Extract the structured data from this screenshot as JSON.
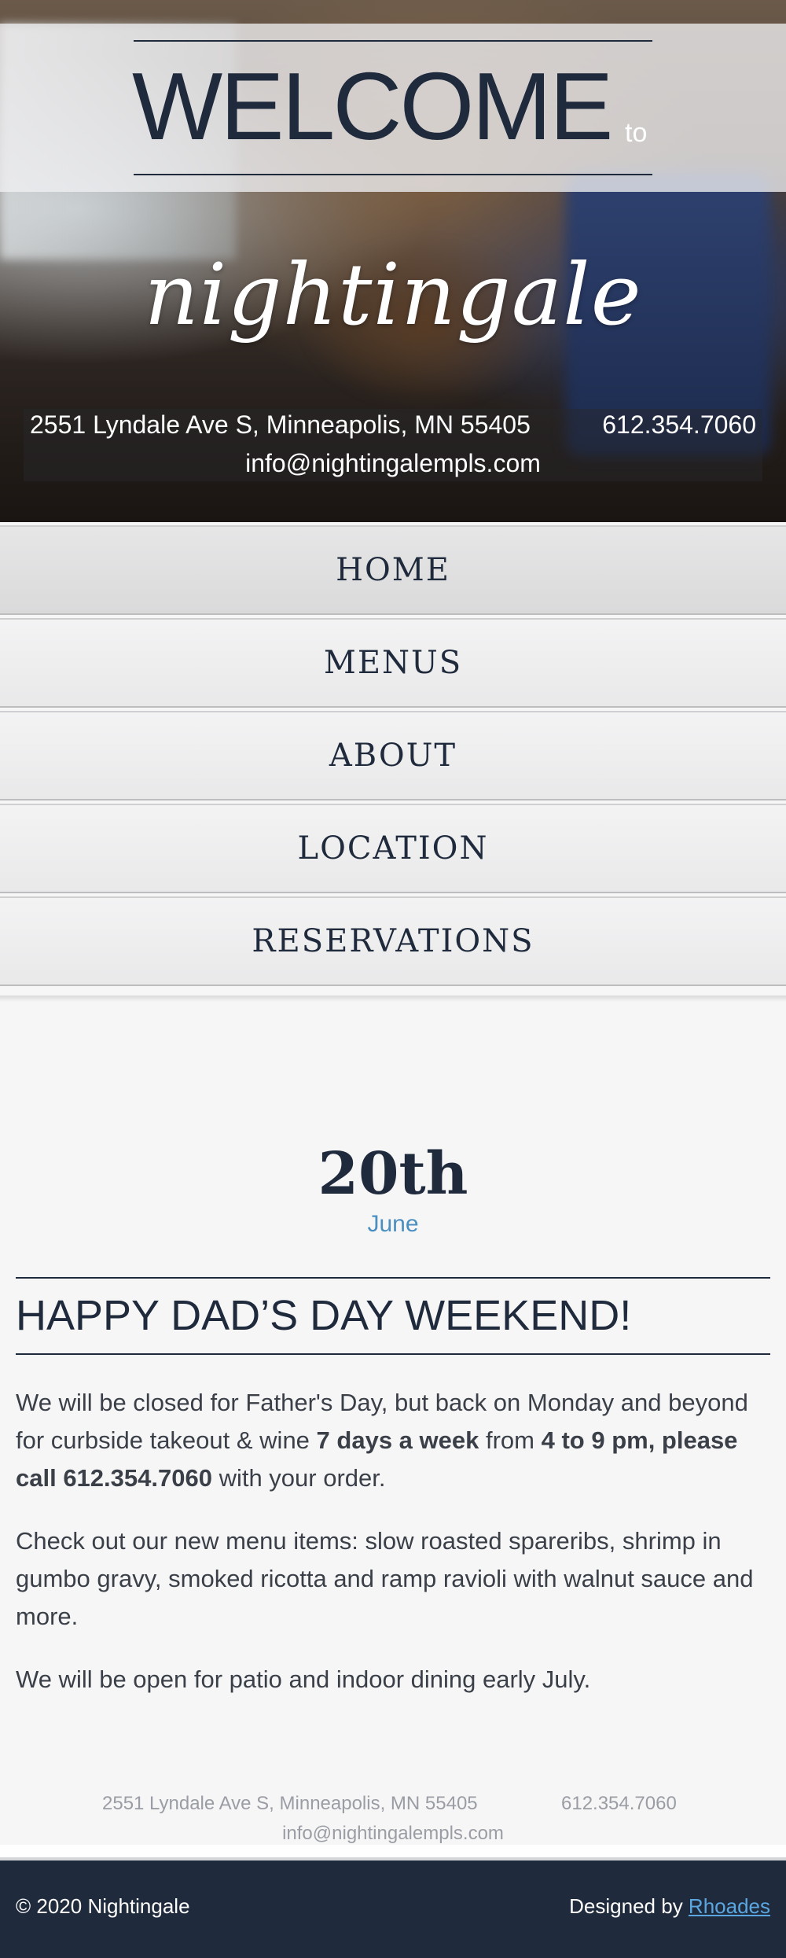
{
  "hero": {
    "welcome": "WELCOME",
    "to": "to",
    "logo": "nightingale",
    "address": "2551 Lyndale Ave S, Minneapolis, MN 55405",
    "phone": "612.354.7060",
    "email": "info@nightingalempls.com"
  },
  "nav": {
    "items": [
      {
        "label": "HOME"
      },
      {
        "label": "MENUS"
      },
      {
        "label": "ABOUT"
      },
      {
        "label": "LOCATION"
      },
      {
        "label": "RESERVATIONS"
      }
    ]
  },
  "post": {
    "day": "20th",
    "month": "June",
    "title": "HAPPY DAD’S DAY WEEKEND!",
    "p1_a": "We will be closed for Father's Day, but back on Monday and be­yond for curbside takeout & wine ",
    "p1_b": "7 days a week",
    "p1_c": " from ",
    "p1_d": "4 to 9 pm, please call 612.354.7060",
    "p1_e": " with your order.",
    "p2": "Check out our new menu items: slow roasted spareribs, shrimp in gumbo gravy, smoked ricotta and ramp ravioli with walnut sauce and more.",
    "p3": "We will be open for patio and indoor dining early July."
  },
  "contact": {
    "address": "2551 Lyndale Ave S, Minneapolis, MN 55405",
    "phone": "612.354.7060",
    "email": "info@nightingalempls.com"
  },
  "footer": {
    "copyright": "© 2020 Nightingale",
    "credit_prefix": "Designed by ",
    "credit_link": "Rhoades"
  },
  "colors": {
    "navy": "#1f2a3c",
    "accent_blue": "#4a8fc0",
    "link_blue": "#5aa6e0"
  }
}
